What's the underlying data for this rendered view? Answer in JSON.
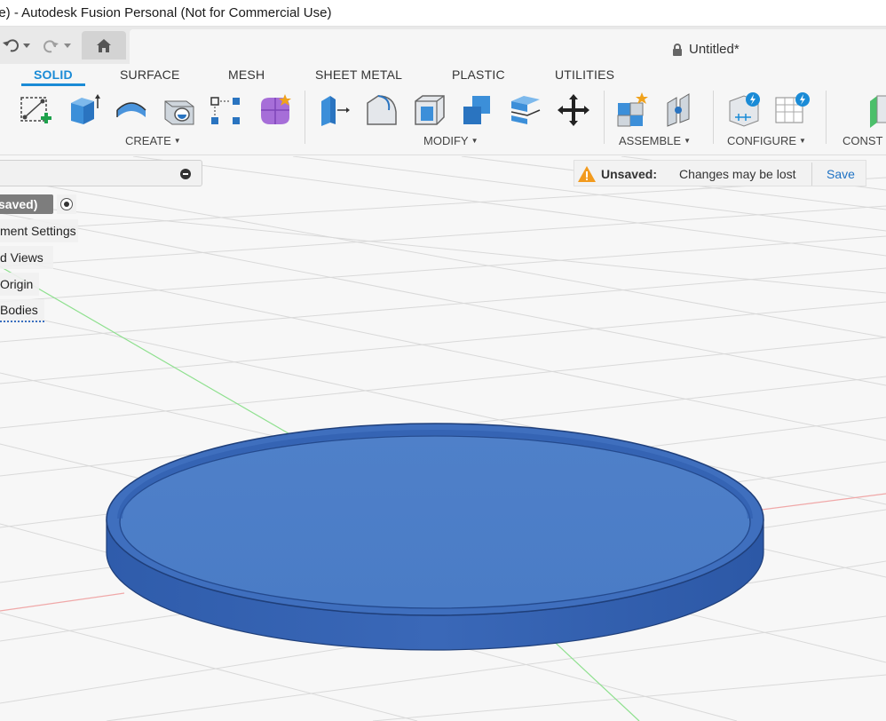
{
  "window": {
    "title": "pe) - Autodesk Fusion Personal (Not for Commercial Use)"
  },
  "document": {
    "tab_title": "Untitled*"
  },
  "ribbon": {
    "tabs": [
      {
        "label": "SOLID",
        "active": true
      },
      {
        "label": "SURFACE",
        "active": false
      },
      {
        "label": "MESH",
        "active": false
      },
      {
        "label": "SHEET METAL",
        "active": false
      },
      {
        "label": "PLASTIC",
        "active": false
      },
      {
        "label": "UTILITIES",
        "active": false
      }
    ],
    "groups": {
      "create": "CREATE",
      "modify": "MODIFY",
      "assemble": "ASSEMBLE",
      "configure": "CONFIGURE",
      "construct": "CONST"
    }
  },
  "browser": {
    "root": "saved)",
    "items": [
      "ment Settings",
      "d Views",
      "Origin",
      "Bodies"
    ]
  },
  "notice": {
    "label": "Unsaved:",
    "message": "Changes may be lost",
    "action": "Save"
  },
  "colors": {
    "accent": "#1a8bd6",
    "body_fill": "#4a7dc7",
    "body_rim": "#2f5cab",
    "warning": "#f29a1d"
  }
}
